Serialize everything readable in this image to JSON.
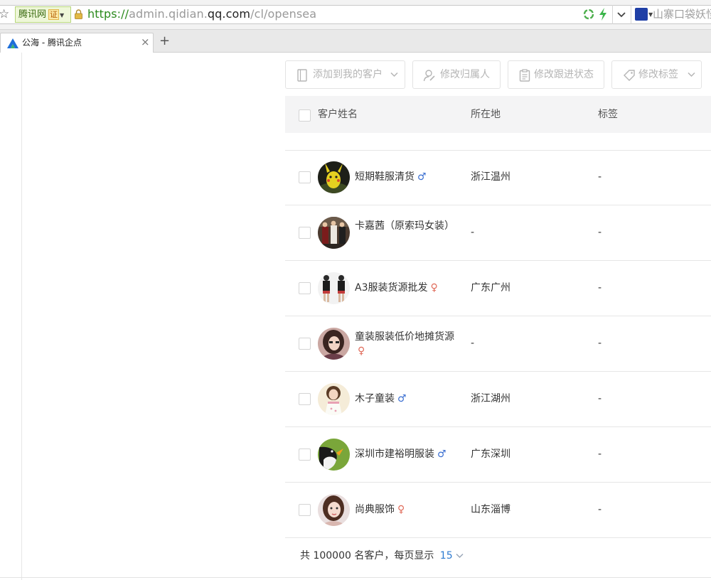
{
  "browser": {
    "cert_label": "腾讯网",
    "cert_badge": "证",
    "url_scheme": "https://",
    "url_pre": "admin.qidian.",
    "url_domain": "qq.com",
    "url_path": "/cl/opensea",
    "search_text": "山寨口袋妖怪",
    "tab_title": "公海 - 腾讯企点",
    "new_tab": "+",
    "close_tab": "×"
  },
  "toolbar": {
    "add_to_mine": "添加到我的客户",
    "change_owner": "修改归属人",
    "change_follow": "修改跟进状态",
    "change_tag": "修改标签"
  },
  "table": {
    "headers": {
      "name": "客户姓名",
      "location": "所在地",
      "tag": "标签"
    },
    "rows": [
      {
        "name": "短期鞋服清货",
        "gender": "♂",
        "gender_kind": "male",
        "location": "浙江温州",
        "tag": "-"
      },
      {
        "name": "卡嘉茜（原索玛女装）",
        "gender": "",
        "gender_kind": "",
        "location": "-",
        "tag": "-"
      },
      {
        "name": "A3服装货源批发",
        "gender": "♀",
        "gender_kind": "female",
        "location": "广东广州",
        "tag": "-"
      },
      {
        "name": "童装服装低价地摊货源",
        "gender": "♀",
        "gender_kind": "female",
        "location": "-",
        "tag": "-"
      },
      {
        "name": "木子童装",
        "gender": "♂",
        "gender_kind": "male",
        "location": "浙江湖州",
        "tag": "-"
      },
      {
        "name": "深圳市建裕明服装",
        "gender": "♂",
        "gender_kind": "male",
        "location": "广东深圳",
        "tag": "-"
      },
      {
        "name": "尚典服饰",
        "gender": "♀",
        "gender_kind": "female",
        "location": "山东淄博",
        "tag": "-"
      }
    ]
  },
  "footer": {
    "summary": "共 100000 名客户，每页显示",
    "page_size": "15"
  },
  "colors": {
    "accent_blue": "#2e7bd1",
    "male": "#3b6fd1",
    "female": "#e06b5a",
    "url_green": "#2b8a1c"
  }
}
